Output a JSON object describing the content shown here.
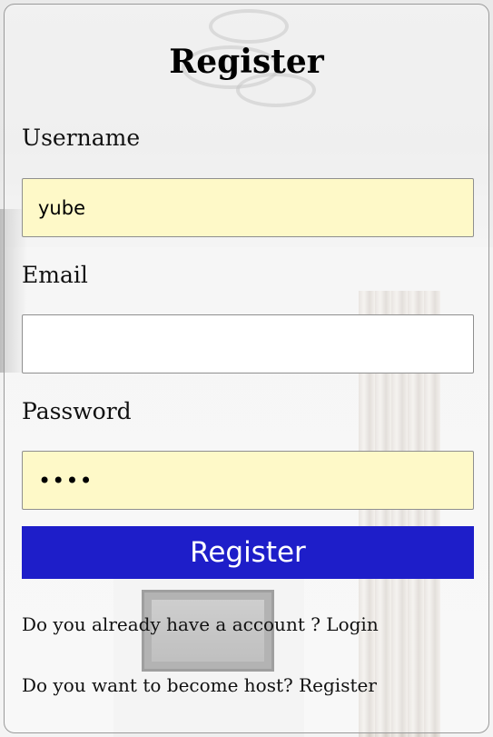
{
  "form": {
    "title": "Register",
    "username_label": "Username",
    "username_value": "yube",
    "email_label": "Email",
    "email_value": "",
    "password_label": "Password",
    "password_value": "••••",
    "submit_label": "Register"
  },
  "footer": {
    "login_prompt": "Do you already have a account ?",
    "login_link": "Login",
    "host_prompt": "Do you want to become host?",
    "host_link": "Register"
  },
  "colors": {
    "button_bg": "#1e1ec9",
    "autofill_bg": "#fef9c8"
  }
}
